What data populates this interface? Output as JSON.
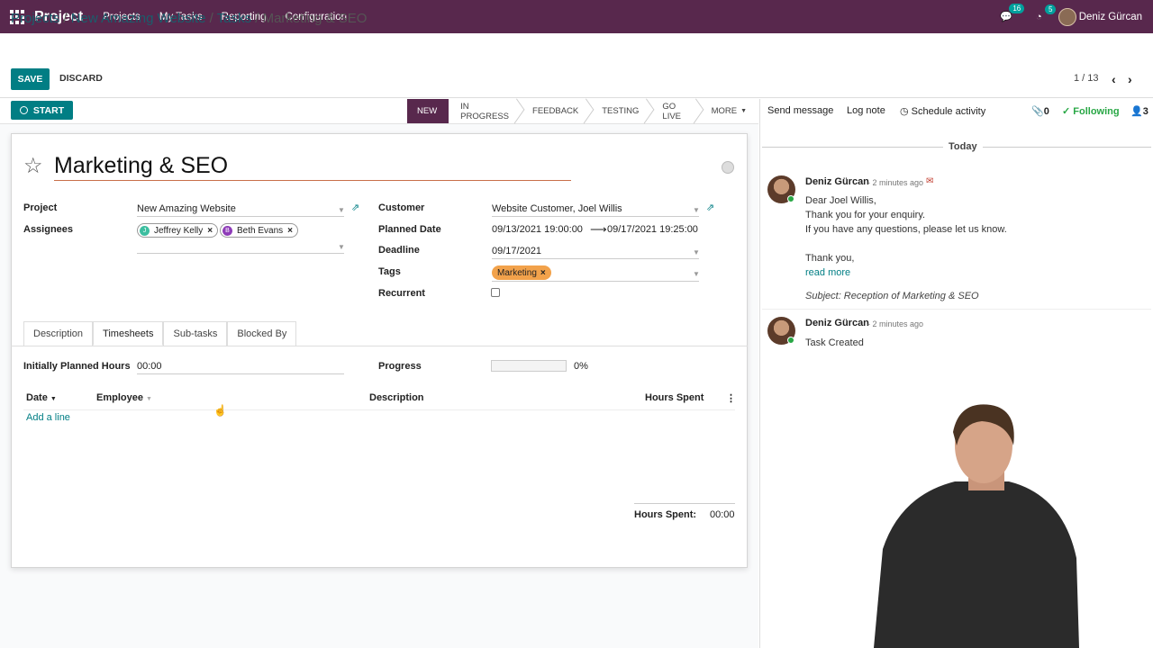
{
  "navbar": {
    "app_name": "Project",
    "menus": [
      "Projects",
      "My Tasks",
      "Reporting",
      "Configuration"
    ],
    "messages_count": "16",
    "activities_count": "5",
    "user_name": "Deniz Gürcan"
  },
  "breadcrumb": {
    "part1": "Projects",
    "sep": " / ",
    "part2": "New Amazing Website",
    "part3": "Tasks",
    "current": "Marketing & SEO"
  },
  "buttons": {
    "save": "SAVE",
    "discard": "DISCARD",
    "start": "START"
  },
  "pager": {
    "value": "1 / 13"
  },
  "stages": {
    "new": "NEW",
    "in_progress": "IN PROGRESS",
    "feedback": "FEEDBACK",
    "testing": "TESTING",
    "go_live": "GO LIVE",
    "more": "MORE"
  },
  "task": {
    "title": "Marketing & SEO",
    "project_label": "Project",
    "project_value": "New Amazing Website",
    "assignees_label": "Assignees",
    "assignees": [
      {
        "initial": "J",
        "name": "Jeffrey Kelly",
        "color": "#3dbea0"
      },
      {
        "initial": "B",
        "name": "Beth Evans",
        "color": "#8e3cb8"
      }
    ],
    "customer_label": "Customer",
    "customer_value": "Website Customer, Joel Willis",
    "planned_date_label": "Planned Date",
    "planned_start": "09/13/2021 19:00:00",
    "planned_end": "09/17/2021 19:25:00",
    "deadline_label": "Deadline",
    "deadline_value": "09/17/2021",
    "tags_label": "Tags",
    "tag": "Marketing",
    "recurrent_label": "Recurrent",
    "recurrent": false
  },
  "tabs": [
    "Description",
    "Timesheets",
    "Sub-tasks",
    "Blocked By"
  ],
  "timesheet": {
    "planned_hours_label": "Initially Planned Hours",
    "planned_hours": "00:00",
    "progress_label": "Progress",
    "progress": "0%",
    "col_date": "Date",
    "col_employee": "Employee",
    "col_description": "Description",
    "col_hours": "Hours Spent",
    "add_line": "Add a line",
    "total_label": "Hours Spent:",
    "total": "00:00"
  },
  "chatter": {
    "send_message": "Send message",
    "log_note": "Log note",
    "schedule_activity": "Schedule activity",
    "attachments": "0",
    "following": "Following",
    "followers": "3",
    "today": "Today",
    "messages": [
      {
        "author": "Deniz Gürcan",
        "time": "- 2 minutes ago",
        "lines": [
          "Dear Joel Willis,",
          "Thank you for your enquiry.",
          "If you have any questions, please let us know.",
          "",
          "Thank you,"
        ],
        "read_more": "read more",
        "subject": "Subject: Reception of Marketing & SEO"
      },
      {
        "author": "Deniz Gürcan",
        "time": "- 2 minutes ago",
        "lines": [
          "Task Created"
        ]
      }
    ]
  },
  "colors": {
    "brand": "#58284d",
    "accent": "#017e84",
    "tag": "#f2a24b"
  }
}
